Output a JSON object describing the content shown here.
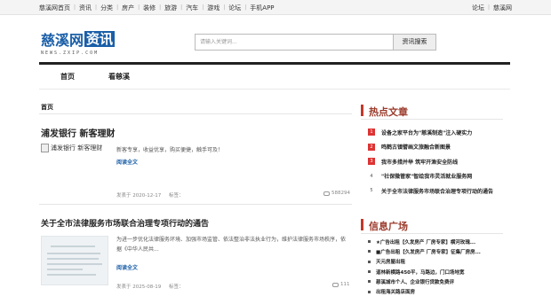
{
  "topbar": {
    "left_links": [
      "慈溪网首页",
      "资讯",
      "分类",
      "房产",
      "装修",
      "旅游",
      "汽车",
      "游戏",
      "论坛",
      "手机APP"
    ],
    "right_links": [
      "论坛",
      "慈溪网"
    ]
  },
  "logo": {
    "text": "慈溪网",
    "box_text": "资讯",
    "subtitle": "NEWS.ZXIP.COM"
  },
  "search": {
    "placeholder": "请输入关键词...",
    "button": "资讯搜索"
  },
  "nav": [
    "首页",
    "看慈溪"
  ],
  "breadcrumb": "首页",
  "articles": [
    {
      "title": "浦发银行 新客理财",
      "image_alt": "浦发银行 新客理财",
      "summary": "新客专享，收益优享，购买便捷，触手可及！",
      "more": "阅读全文",
      "date": "发表于 2020-12-17",
      "tag": "标签：",
      "count": "588294"
    },
    {
      "title": "关于全市法律服务市场联合治理专项行动的通告",
      "summary": "为进一步优化法律服务环境、加强市场监管、依法整治非法执业行为，维护法律服务市场秩序，依据《中华人民共...",
      "more": "阅读全文",
      "date": "发表于 2025-08-19",
      "tag": "标签：",
      "count": "111"
    }
  ],
  "hot": {
    "title": "热点文章",
    "items": [
      {
        "num": "1",
        "text": "设备之家平台为\"慈溪制造\"注入硬实力"
      },
      {
        "num": "2",
        "text": "鸣鹤古镇譬画文旅融合新图景"
      },
      {
        "num": "3",
        "text": "我市多措并举  筑牢开渔安全防线"
      },
      {
        "num": "4",
        "text": "\"社保微管家\"智绘我市灵活就业服务网"
      },
      {
        "num": "5",
        "text": "关于全市法律服务市场联合治理专项行动的通告"
      }
    ]
  },
  "info": {
    "title": "信息广场",
    "items": [
      "★广告出租【久发房产 厂房专家】横河玫瑰...",
      "■广告出租【久发房产 厂房专家】征集厂房房...",
      "天元房屋出租",
      "道林新横路450平，马路边，门口场地宽",
      "慈溪城市个人、企业银行贷款免费评",
      "出租海关路店面房"
    ]
  },
  "colors": {
    "brand": "#1b5fa8",
    "hot_accent": "#c0392b",
    "link": "#1b5fa8"
  }
}
